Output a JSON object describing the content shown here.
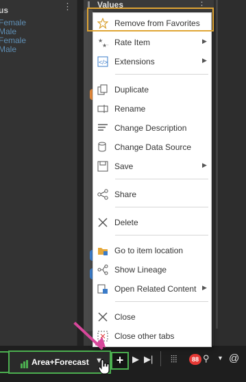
{
  "left_panel": {
    "header": "us",
    "legend": [
      "Female",
      "Male",
      "Female",
      "Male"
    ],
    "legend_color": "#5f8fb5"
  },
  "values_panel": {
    "title": "Values"
  },
  "context_menu": {
    "items": [
      {
        "label": "Remove from Favorites",
        "icon": "star-outline-icon",
        "submenu": false
      },
      {
        "label": "Rate Item",
        "icon": "rate-stars-icon",
        "submenu": true
      },
      {
        "label": "Extensions",
        "icon": "code-extension-icon",
        "submenu": true
      },
      {
        "label": "Duplicate",
        "icon": "duplicate-icon",
        "submenu": false
      },
      {
        "label": "Rename",
        "icon": "rename-icon",
        "submenu": false
      },
      {
        "label": "Change Description",
        "icon": "description-icon",
        "submenu": false
      },
      {
        "label": "Change Data Source",
        "icon": "database-icon",
        "submenu": false
      },
      {
        "label": "Save",
        "icon": "save-icon",
        "submenu": true
      },
      {
        "label": "Share",
        "icon": "share-icon",
        "submenu": false
      },
      {
        "label": "Delete",
        "icon": "delete-x-icon",
        "submenu": false
      },
      {
        "label": "Go to item location",
        "icon": "folder-location-icon",
        "submenu": false
      },
      {
        "label": "Show Lineage",
        "icon": "lineage-icon",
        "submenu": false
      },
      {
        "label": "Open Related Content",
        "icon": "related-content-icon",
        "submenu": true
      },
      {
        "label": "Close",
        "icon": "close-x-icon",
        "submenu": false
      },
      {
        "label": "Close other tabs",
        "icon": "close-other-tabs-icon",
        "submenu": false
      }
    ],
    "highlighted_item": "Remove from Favorites",
    "highlight_color": "#e0a534"
  },
  "tabbar": {
    "active_tab": {
      "label": "Area+Forecast",
      "icon": "bar-chart-icon"
    },
    "badge_count": "88",
    "accent_color": "#4caf50"
  },
  "annotation": {
    "arrow_color": "#d7479a"
  }
}
